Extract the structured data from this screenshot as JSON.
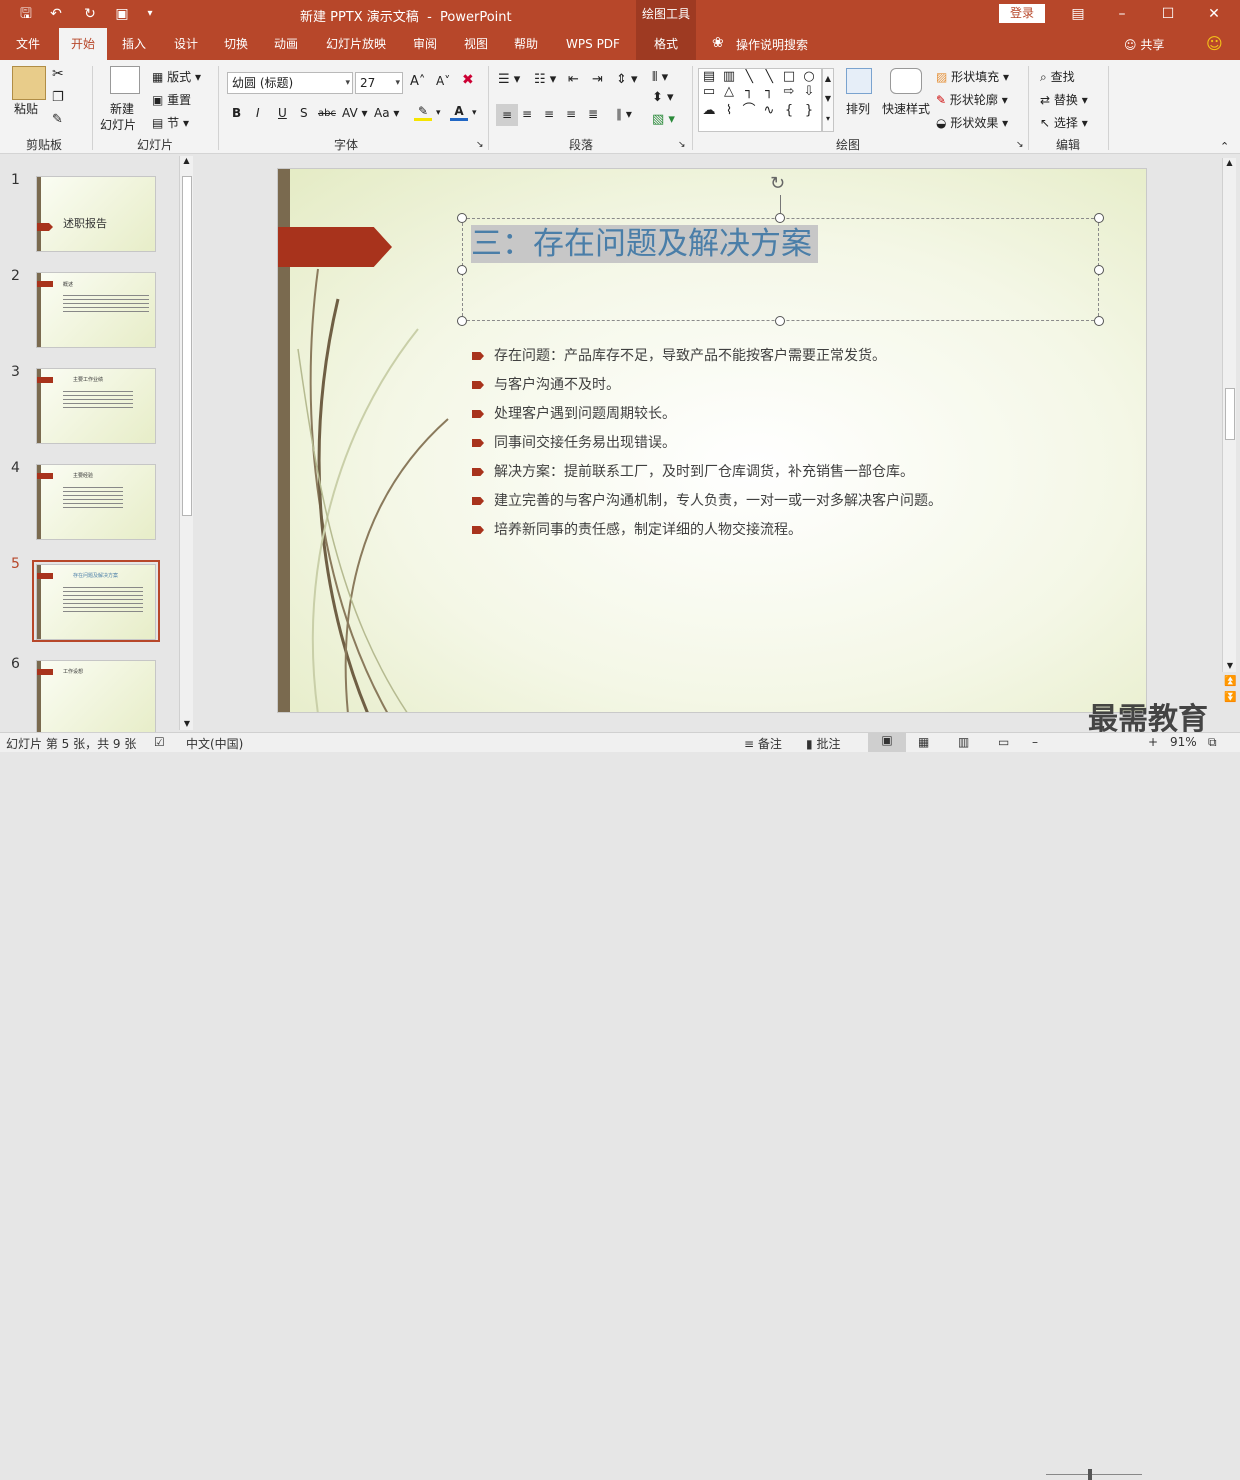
{
  "app": {
    "document_title": "新建 PPTX 演示文稿",
    "separator": "-",
    "app_name": "PowerPoint",
    "context_tab_group": "绘图工具",
    "login_label": "登录"
  },
  "tabs": [
    "文件",
    "开始",
    "插入",
    "设计",
    "切换",
    "动画",
    "幻灯片放映",
    "审阅",
    "视图",
    "帮助",
    "WPS PDF",
    "格式"
  ],
  "search_tab_label": "操作说明搜索",
  "share_label": "共享",
  "ribbon": {
    "clipboard": {
      "paste": "粘贴",
      "group": "剪贴板"
    },
    "slides": {
      "new_slide_line1": "新建",
      "new_slide_line2": "幻灯片",
      "layout": "版式",
      "reset": "重置",
      "section": "节",
      "group": "幻灯片"
    },
    "font": {
      "font_name": "幼圆 (标题)",
      "font_size": "27",
      "group": "字体",
      "case_label": "Aa"
    },
    "paragraph": {
      "group": "段落"
    },
    "drawing": {
      "arrange": "排列",
      "quick_styles": "快速样式",
      "shape_fill": "形状填充",
      "shape_outline": "形状轮廓",
      "shape_effects": "形状效果",
      "group": "绘图"
    },
    "editing": {
      "find": "查找",
      "replace": "替换",
      "select": "选择",
      "group": "编辑"
    }
  },
  "slides_panel": [
    {
      "num": "1",
      "title": "述职报告"
    },
    {
      "num": "2",
      "title": "概述"
    },
    {
      "num": "3",
      "title": "主要工作业绩"
    },
    {
      "num": "4",
      "title": "主要经验"
    },
    {
      "num": "5",
      "title": "存在问题及解决方案"
    },
    {
      "num": "6",
      "title": "工作设想"
    }
  ],
  "selected_slide": "5",
  "slide": {
    "title": "三：存在问题及解决方案",
    "bullets": [
      "存在问题：产品库存不足，导致产品不能按客户需要正常发货。",
      "与客户沟通不及时。",
      "处理客户遇到问题周期较长。",
      "同事间交接任务易出现错误。",
      "解决方案：提前联系工厂，及时到厂仓库调货，补充销售一部仓库。",
      "建立完善的与客户沟通机制，专人负责，一对一或一对多解决客户问题。",
      "培养新同事的责任感，制定详细的人物交接流程。"
    ]
  },
  "status": {
    "slide_info": "幻灯片 第 5 张，共 9 张",
    "language": "中文(中国)",
    "notes": "备注",
    "comments": "批注",
    "zoom": "91%"
  },
  "watermark": "最需教育",
  "colors": {
    "accent": "#b7472a",
    "slide_title": "#4a7ea8",
    "bullet": "#a8331c"
  }
}
